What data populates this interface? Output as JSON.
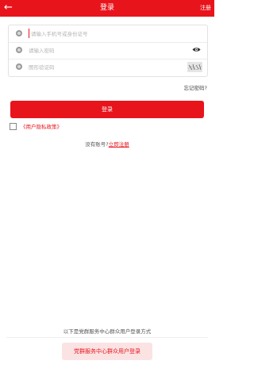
{
  "header": {
    "back_icon": "arrow-left-icon",
    "title": "登录",
    "register_label": "注册"
  },
  "form": {
    "account_placeholder": "请输入手机号或身份证号",
    "password_placeholder": "请输入密码",
    "captcha_placeholder": "图形验证码",
    "field_icon": "user-circle-icon",
    "password_toggle_icon": "eye-icon",
    "captcha_image": "captcha-image"
  },
  "forgot_label": "忘记密码?",
  "login_button_label": "登录",
  "agreement": {
    "checked": false,
    "link_label": "《用户隐私政策》"
  },
  "no_account": {
    "prompt": "没有账号?",
    "register_link": "立即注册"
  },
  "other_login": {
    "caption": "以下是党群服务中心群众用户登录方式",
    "button_label": "党群服务中心群众用户登录"
  },
  "colors": {
    "primary": "#e8141c",
    "primary_light": "#fbe3e3"
  }
}
